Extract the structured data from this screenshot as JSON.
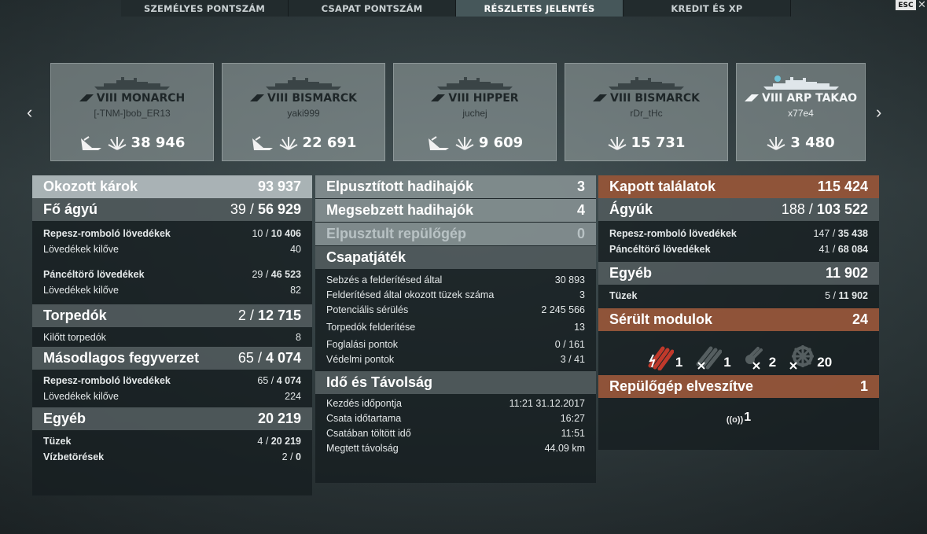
{
  "tabs": [
    "SZEMÉLYES PONTSZÁM",
    "CSAPAT PONTSZÁM",
    "RÉSZLETES JELENTÉS",
    "KREDIT ÉS XP"
  ],
  "esc": "ESC",
  "cards": [
    {
      "ship": "VIII MONARCH",
      "player": "[-TNM-]bob_ER13",
      "damage": "38 946"
    },
    {
      "ship": "VIII BISMARCK",
      "player": "yaki999",
      "damage": "22 691"
    },
    {
      "ship": "VIII HIPPER",
      "player": "juchej",
      "damage": "9 609"
    },
    {
      "ship": "VIII BISMARCK",
      "player": "rDr_tHc",
      "damage": "15 731"
    },
    {
      "ship": "VIII ARP TAKAO",
      "player": "x77e4",
      "damage": "3 480"
    }
  ],
  "left": {
    "dealt": {
      "label": "Okozott károk",
      "value": "93 937"
    },
    "main": {
      "label": "Fő ágyú",
      "hits": "39",
      "value": "56 929",
      "he": {
        "label": "Repesz-romboló lövedékek",
        "hits": "10",
        "value": "10 406"
      },
      "he_fired": {
        "label": "Lövedékek kilőve",
        "value": "40"
      },
      "ap": {
        "label": "Páncéltörő lövedékek",
        "hits": "29",
        "value": "46 523"
      },
      "ap_fired": {
        "label": "Lövedékek kilőve",
        "value": "82"
      }
    },
    "torp": {
      "label": "Torpedók",
      "hits": "2",
      "value": "12 715",
      "fired": {
        "label": "Kilőtt torpedók",
        "value": "8"
      }
    },
    "sec": {
      "label": "Másodlagos fegyverzet",
      "hits": "65",
      "value": "4 074",
      "he": {
        "label": "Repesz-romboló lövedékek",
        "hits": "65",
        "value": "4 074"
      },
      "fired": {
        "label": "Lövedékek kilőve",
        "value": "224"
      }
    },
    "other": {
      "label": "Egyéb",
      "value": "20 219",
      "fires": {
        "label": "Tüzek",
        "hits": "4",
        "value": "20 219"
      },
      "flood": {
        "label": "Vízbetörések",
        "hits": "2",
        "value": "0"
      }
    }
  },
  "mid": {
    "destroyed": {
      "label": "Elpusztított hadihajók",
      "value": "3"
    },
    "damaged": {
      "label": "Megsebzett hadihajók",
      "value": "4"
    },
    "planes": {
      "label": "Elpusztult repülőgép",
      "value": "0"
    },
    "team": {
      "label": "Csapatjáték",
      "rows": [
        {
          "label": "Sebzés a felderítésed által",
          "value": "30 893"
        },
        {
          "label": "Felderítésed által okozott tüzek száma",
          "value": "3"
        },
        {
          "label": "Potenciális sérülés",
          "value": "2 245 566"
        },
        {
          "label": "Torpedók felderítése",
          "value": "13"
        },
        {
          "label": "Foglalási pontok",
          "value": "0 / 161"
        },
        {
          "label": "Védelmi pontok",
          "value": "3 / 41"
        }
      ]
    },
    "time": {
      "label": "Idő és Távolság",
      "rows": [
        {
          "label": "Kezdés időpontja",
          "value": "11:21  31.12.2017"
        },
        {
          "label": "Csata időtartama",
          "value": "16:27"
        },
        {
          "label": "Csatában töltött idő",
          "value": "11:51"
        },
        {
          "label": "Megtett távolság",
          "value": "44.09 km"
        }
      ]
    }
  },
  "right": {
    "received": {
      "label": "Kapott találatok",
      "value": "115 424"
    },
    "guns": {
      "label": "Ágyúk",
      "hits": "188",
      "value": "103 522",
      "he": {
        "label": "Repesz-romboló lövedékek",
        "hits": "147",
        "value": "35 438"
      },
      "ap": {
        "label": "Páncéltörő lövedékek",
        "hits": "41",
        "value": "68 084"
      }
    },
    "other": {
      "label": "Egyéb",
      "value": "11 902",
      "fires": {
        "label": "Tüzek",
        "hits": "5",
        "value": "11 902"
      }
    },
    "modules": {
      "label": "Sérült modulok",
      "value": "24",
      "items": [
        {
          "icon": "torpedo-tubes-icon",
          "count": "1"
        },
        {
          "icon": "main-guns-icon",
          "count": "1"
        },
        {
          "icon": "secondary-guns-icon",
          "count": "2"
        },
        {
          "icon": "steering-icon",
          "count": "20"
        }
      ]
    },
    "planes_lost": {
      "label": "Repülőgép elveszítve",
      "value": "1",
      "radio": "1"
    }
  }
}
